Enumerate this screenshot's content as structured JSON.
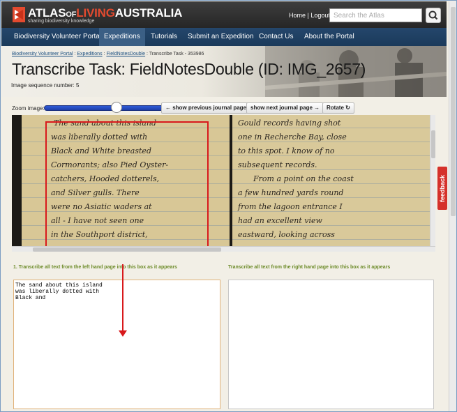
{
  "brand": {
    "name_part1": "ATLAS",
    "name_part2": "OF",
    "name_part3": "LIVING",
    "name_part4": "AUSTRALIA",
    "tagline": "sharing biodiversity knowledge"
  },
  "top_links": {
    "home": "Home",
    "sep": " | ",
    "logout": "Logout"
  },
  "search": {
    "placeholder": "Search the Atlas"
  },
  "nav": [
    {
      "label": "Biodiversity Volunteer Portal"
    },
    {
      "label": "Expeditions"
    },
    {
      "label": "Tutorials"
    },
    {
      "label": "Submit an Expedition"
    },
    {
      "label": "Contact Us"
    },
    {
      "label": "About the Portal"
    }
  ],
  "breadcrumb": {
    "items": [
      "Biodiversity Volunteer Portal",
      "Expeditions",
      "FieldNotesDouble"
    ],
    "sep": " : ",
    "current": "Transcribe Task - 353986"
  },
  "page_title": "Transcribe Task: FieldNotesDouble (ID: IMG_2657)",
  "sequence": "Image sequence number: 5",
  "toolbar": {
    "zoom_label": "Zoom image:",
    "prev_page": "← show previous journal page",
    "next_page": "show next journal page →",
    "rotate": "Rotate"
  },
  "journal": {
    "left_lines": [
      "The sand about this island",
      "was liberally dotted with",
      "Black and White breasted",
      "Cormorants; also Pied Oyster-",
      "catchers, Hooded dotterels,",
      "and Silver gulls. There",
      "were no Asiatic waders at",
      "all - I have not seen one",
      "in the Southport district,"
    ],
    "right_lines": [
      "Gould records having shot",
      "one in Recherche Bay, close",
      "to this spot. I know of no",
      "subsequent records.",
      "From a point on the coast",
      "a few hundred yards round",
      "from the lagoon entrance I",
      "had an excellent view",
      "eastward, looking across"
    ]
  },
  "feedback_label": "feedback",
  "transcription": {
    "left_label": "1. Transcribe all text from the left hand page into this box as it appears",
    "right_label": "Transcribe all text from the right hand page into this box as it appears",
    "left_value": "The sand about this island\nwas liberally dotted with\nBlack and",
    "right_value": ""
  }
}
